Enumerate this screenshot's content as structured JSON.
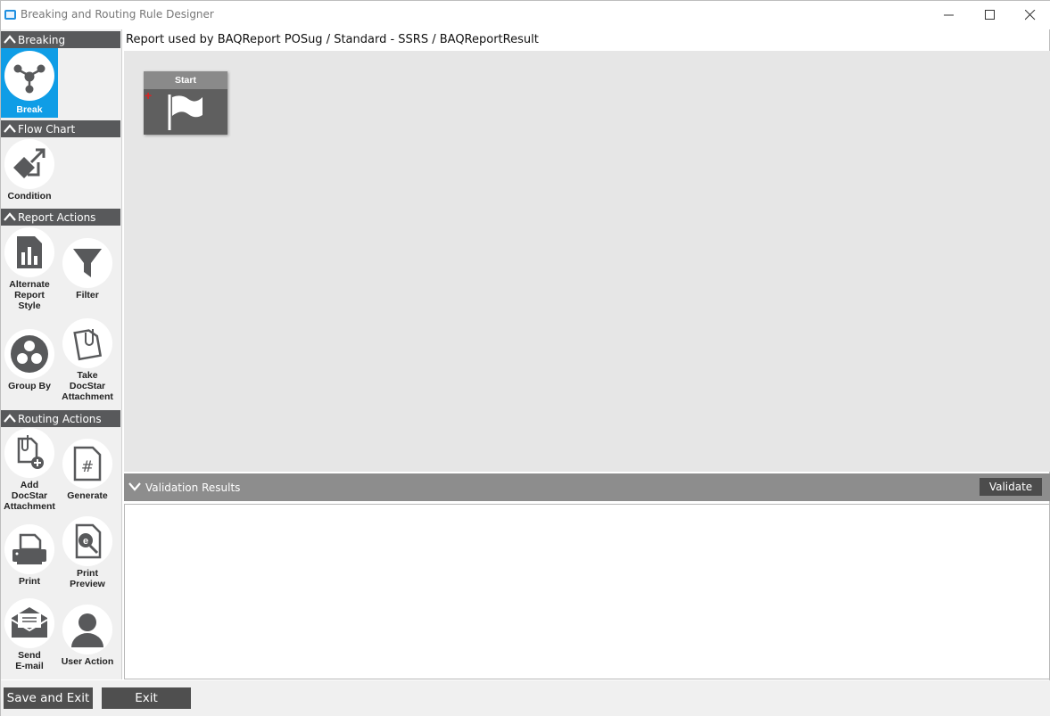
{
  "window": {
    "title": "Breaking and Routing Rule Designer"
  },
  "report_line": "Report used by BAQReport POSug / Standard - SSRS / BAQReportResult",
  "sections": {
    "breaking": "Breaking",
    "flow_chart": "Flow Chart",
    "report_actions": "Report Actions",
    "routing_actions": "Routing Actions"
  },
  "tools": {
    "break": "Break",
    "condition": "Condition",
    "alternate_report_style": [
      "Alternate",
      "Report",
      "Style"
    ],
    "filter": "Filter",
    "group_by": "Group By",
    "take_docstar_attachment": [
      "Take",
      "DocStar",
      "Attachment"
    ],
    "add_docstar_attachment": [
      "Add",
      "DocStar",
      "Attachment"
    ],
    "generate": "Generate",
    "print": "Print",
    "print_preview": [
      "Print",
      "Preview"
    ],
    "send_email": [
      "Send",
      "E-mail"
    ],
    "user_action": "User Action"
  },
  "canvas": {
    "start_node_label": "Start"
  },
  "validation": {
    "label": "Validation Results",
    "button": "Validate"
  },
  "footer": {
    "save_and_exit": "Save and Exit",
    "exit": "Exit"
  },
  "colors": {
    "accent_selected": "#0f9de6",
    "section_header": "#58595b",
    "icon_gray": "#58595b"
  }
}
